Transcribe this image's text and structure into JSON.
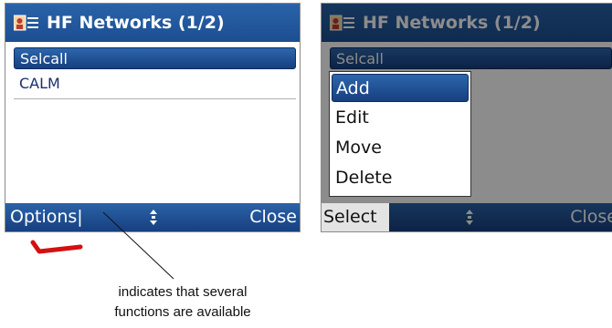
{
  "left_screen": {
    "title": "HF Networks (1/2)",
    "icon": "contact-card-icon",
    "list_items": [
      "Selcall",
      "CALM"
    ],
    "selected_index": 0,
    "softkeys": {
      "left": "Options|",
      "right": "Close"
    }
  },
  "right_screen": {
    "title": "HF Networks (1/2)",
    "icon": "contact-card-icon",
    "background_item": "Selcall",
    "menu_items": [
      "Add",
      "Edit",
      "Move",
      "Delete"
    ],
    "selected_index": 0,
    "softkeys": {
      "left": "Select",
      "right": "Close"
    }
  },
  "annotation": {
    "caption_line1": "indicates that several",
    "caption_line2": "functions are available"
  },
  "colors": {
    "title_bar": "#2a63a8",
    "selection": "#1c4e91",
    "pointer_mark": "#d41010"
  }
}
